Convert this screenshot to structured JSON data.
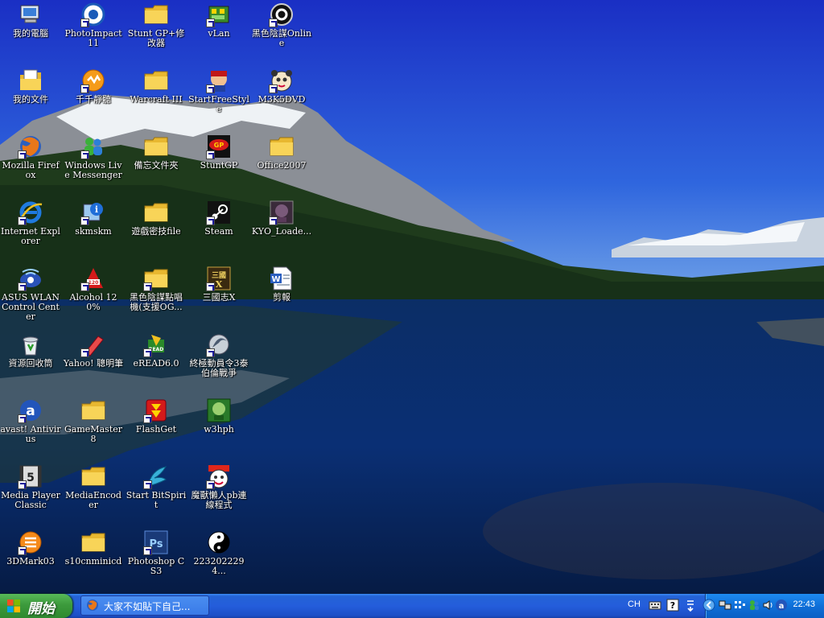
{
  "desktop": {
    "icons": [
      {
        "label": "我的電腦",
        "icon": "my-computer-icon",
        "shortcut": false
      },
      {
        "label": "PhotoImpact 11",
        "icon": "photoimpact-icon",
        "shortcut": true
      },
      {
        "label": "Stunt GP+修改器",
        "icon": "folder-icon",
        "shortcut": false
      },
      {
        "label": "vLan",
        "icon": "vlan-icon",
        "shortcut": true
      },
      {
        "label": "黑色陰謀Online",
        "icon": "black-conspiracy-icon",
        "shortcut": true
      },
      {
        "label": "我的文件",
        "icon": "my-documents-icon",
        "shortcut": false
      },
      {
        "label": "千千靜聽",
        "icon": "ttplayer-icon",
        "shortcut": true
      },
      {
        "label": "Warcraft III",
        "icon": "folder-icon",
        "shortcut": false
      },
      {
        "label": "StartFreeStyle",
        "icon": "freestyle-icon",
        "shortcut": true
      },
      {
        "label": "M3K5DVD",
        "icon": "panda-icon",
        "shortcut": true
      },
      {
        "label": "Mozilla Firefox",
        "icon": "firefox-icon",
        "shortcut": true
      },
      {
        "label": "Windows Live Messenger",
        "icon": "messenger-icon",
        "shortcut": true
      },
      {
        "label": "備忘文件夾",
        "icon": "folder-icon",
        "shortcut": false
      },
      {
        "label": "StuntGP",
        "icon": "stuntgp-icon",
        "shortcut": true
      },
      {
        "label": "Office2007",
        "icon": "folder-icon",
        "shortcut": false
      },
      {
        "label": "Internet Explorer",
        "icon": "internet-explorer-icon",
        "shortcut": true
      },
      {
        "label": "skmskm",
        "icon": "info-icon",
        "shortcut": true
      },
      {
        "label": "遊戲密技file",
        "icon": "folder-icon",
        "shortcut": false
      },
      {
        "label": "Steam",
        "icon": "steam-icon",
        "shortcut": true
      },
      {
        "label": "KYO_Loade...",
        "icon": "kyo-icon",
        "shortcut": true
      },
      {
        "label": "ASUS WLAN Control Center",
        "icon": "asus-wlan-icon",
        "shortcut": true
      },
      {
        "label": "Alcohol 120%",
        "icon": "alcohol-icon",
        "shortcut": true
      },
      {
        "label": "黑色陰謀點唱機(支援OG...",
        "icon": "folder-icon",
        "shortcut": true
      },
      {
        "label": "三國志X",
        "icon": "sangokushi-icon",
        "shortcut": true
      },
      {
        "label": "剪報",
        "icon": "word-document-icon",
        "shortcut": false
      },
      {
        "label": "資源回收筒",
        "icon": "recycle-bin-icon",
        "shortcut": false
      },
      {
        "label": "Yahoo! 聰明筆",
        "icon": "yahoo-pen-icon",
        "shortcut": true
      },
      {
        "label": "eREAD6.0",
        "icon": "eread-icon",
        "shortcut": true
      },
      {
        "label": "終極動員令3泰伯倫戰爭",
        "icon": "cnc3-icon",
        "shortcut": true
      },
      {
        "label": "avast! Antivirus",
        "icon": "avast-icon",
        "shortcut": true
      },
      {
        "label": "GameMaster8",
        "icon": "folder-icon",
        "shortcut": false
      },
      {
        "label": "FlashGet",
        "icon": "flashget-icon",
        "shortcut": true
      },
      {
        "label": "w3hph",
        "icon": "w3hph-icon",
        "shortcut": false
      },
      {
        "label": "Media Player Classic",
        "icon": "media-player-classic-icon",
        "shortcut": true
      },
      {
        "label": "MediaEncoder",
        "icon": "folder-icon",
        "shortcut": false
      },
      {
        "label": "Start BitSpirit",
        "icon": "bitspirit-icon",
        "shortcut": true
      },
      {
        "label": "魔獸懶人pb連線程式",
        "icon": "warcraft-lazy-icon",
        "shortcut": true
      },
      {
        "label": "3DMark03",
        "icon": "3dmark-icon",
        "shortcut": true
      },
      {
        "label": "s10cnminicd",
        "icon": "folder-icon",
        "shortcut": false
      },
      {
        "label": "Photoshop CS3",
        "icon": "photoshop-icon",
        "shortcut": true
      },
      {
        "label": "2232022294...",
        "icon": "yin-yang-icon",
        "shortcut": false
      }
    ]
  },
  "taskbar": {
    "start_label": "開始",
    "window_button": "大家不如貼下自己...",
    "language": "CH",
    "clock": "22:43"
  },
  "colors": {
    "taskbar": "#245ddb",
    "start": "#3c9a3c",
    "tray": "#0f6fd8"
  }
}
